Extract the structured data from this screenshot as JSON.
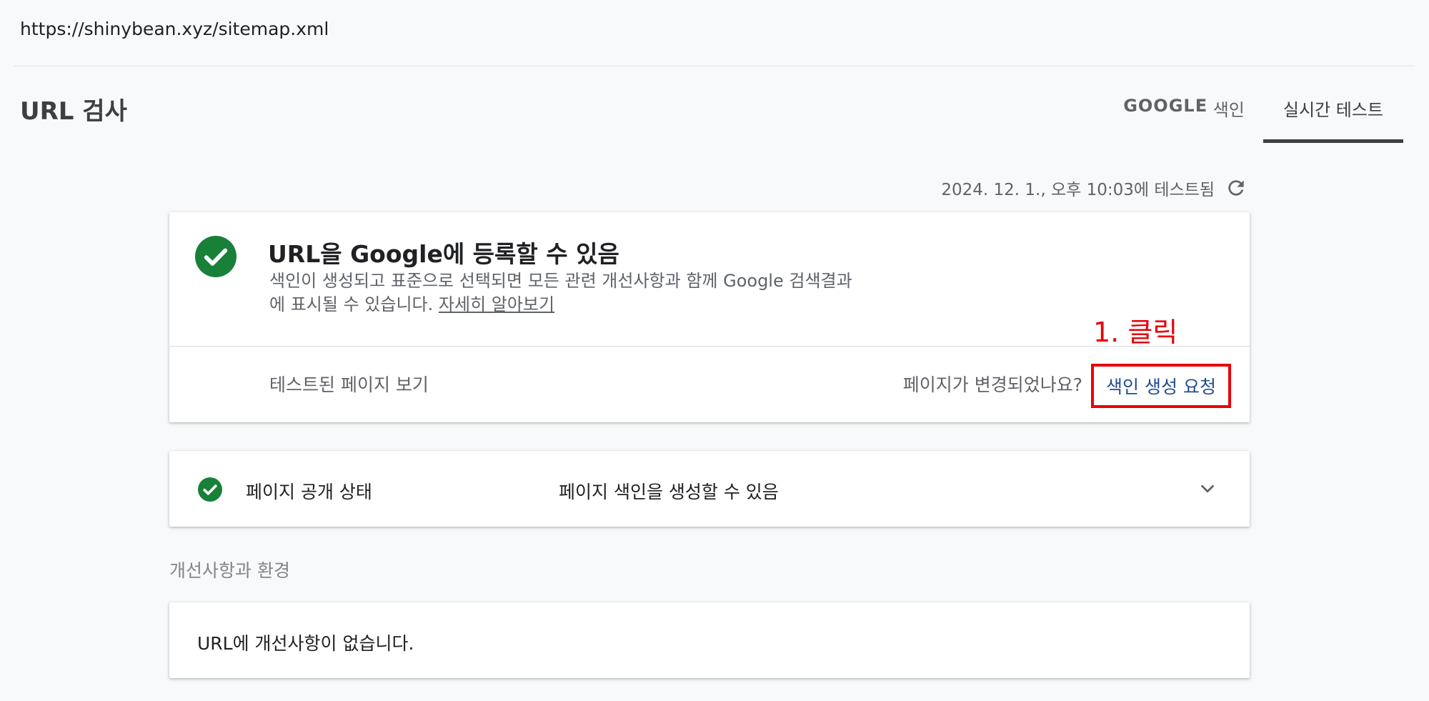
{
  "url_bar": {
    "url": "https://shinybean.xyz/sitemap.xml"
  },
  "page": {
    "title": "URL 검사"
  },
  "tabs": [
    {
      "label_strong": "GOOGLE",
      "label_rest": " 색인",
      "active": false
    },
    {
      "label": "실시간 테스트",
      "active": true
    }
  ],
  "test_info": {
    "tested_at": "2024. 12. 1., 오후 10:03에 테스트됨",
    "icon": "refresh-icon"
  },
  "result": {
    "icon": "check-circle-icon",
    "title": "URL을 Google에 등록할 수 있음",
    "description_line1": "색인이 생성되고 표준으로 선택되면 모든 관련 개선사항과 함께 Google 검색결과",
    "description_line2": "에 표시될 수 있습니다. ",
    "learn_more": "자세히 알아보기",
    "view_tested": "테스트된 페이지 보기",
    "changed_question": "페이지가 변경되었나요?",
    "request_indexing": "색인 생성 요청"
  },
  "annotation": {
    "text": "1. 클릭"
  },
  "status": {
    "label": "페이지 공개 상태",
    "value": "페이지 색인을 생성할 수 있음"
  },
  "enhancements": {
    "heading": "개선사항과 환경",
    "message": "URL에 개선사항이 없습니다."
  },
  "colors": {
    "success_green": "#188038",
    "annotation_red": "#e8000b",
    "link_blue": "#1f4d8f"
  }
}
